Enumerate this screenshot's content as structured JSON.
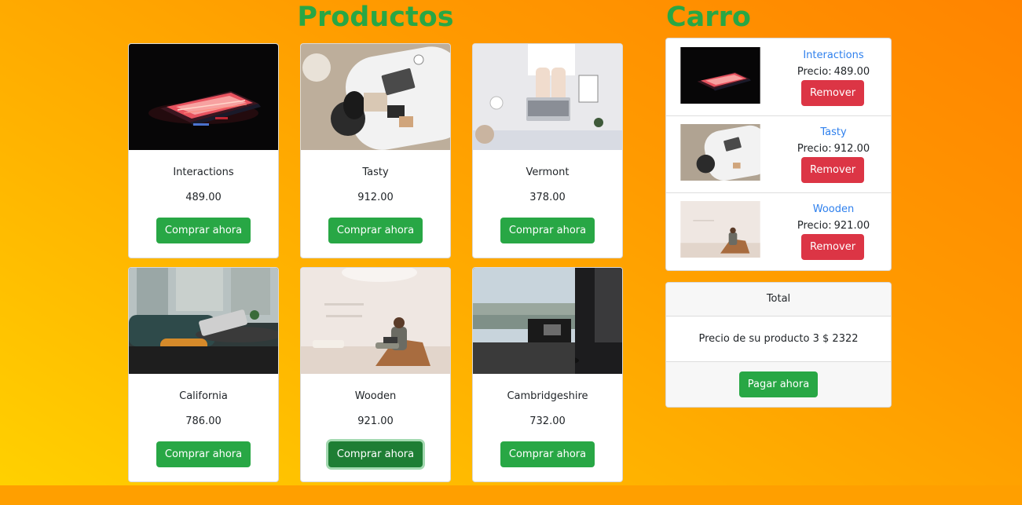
{
  "productos_title": "Productos",
  "carro_title": "Carro",
  "products": [
    {
      "name": "Interactions",
      "price": "489.00",
      "button": "Comprar ahora"
    },
    {
      "name": "Tasty",
      "price": "912.00",
      "button": "Comprar ahora"
    },
    {
      "name": "Vermont",
      "price": "378.00",
      "button": "Comprar ahora"
    },
    {
      "name": "California",
      "price": "786.00",
      "button": "Comprar ahora"
    },
    {
      "name": "Wooden",
      "price": "921.00",
      "button": "Comprar ahora"
    },
    {
      "name": "Cambridgeshire",
      "price": "732.00",
      "button": "Comprar ahora"
    }
  ],
  "cart": {
    "items": [
      {
        "name": "Interactions",
        "price_label": "Precio:",
        "price": "489.00",
        "remove": "Remover"
      },
      {
        "name": "Tasty",
        "price_label": "Precio:",
        "price": "912.00",
        "remove": "Remover"
      },
      {
        "name": "Wooden",
        "price_label": "Precio:",
        "price": "921.00",
        "remove": "Remover"
      }
    ],
    "total_header": "Total",
    "total_text": "Precio de su producto 3 $ 2322",
    "pay_button": "Pagar ahora"
  },
  "colors": {
    "accent_green": "#28a745",
    "danger_red": "#dc3545",
    "link_blue": "#2f80ed"
  }
}
